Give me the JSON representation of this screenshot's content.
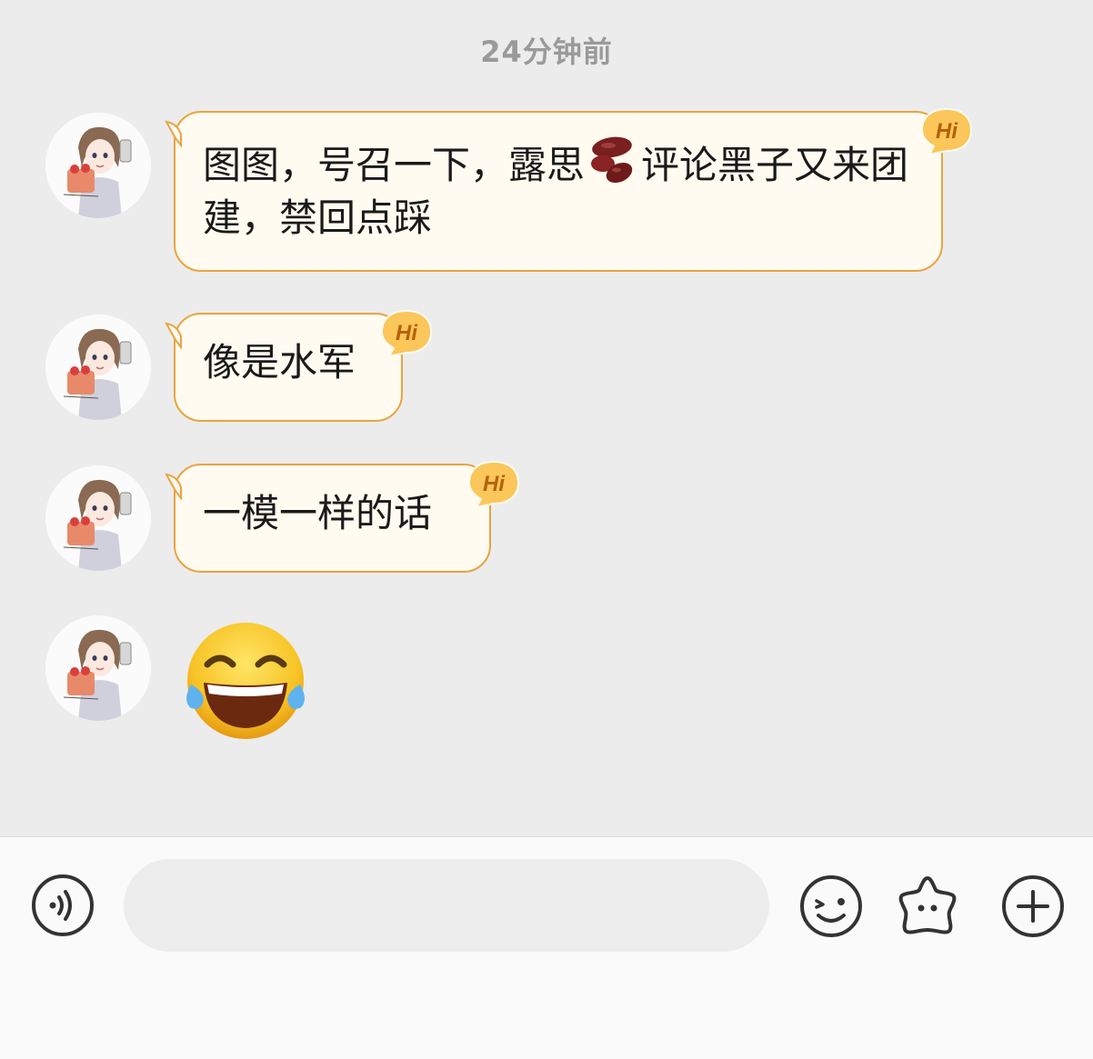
{
  "chat": {
    "timestamp": "24分钟前",
    "messages": [
      {
        "type": "text",
        "text": "图图，号召一下，露思",
        "emoji": "kidney-bean",
        "text_after": "评论黑子又来团建，禁回点踩"
      },
      {
        "type": "text",
        "text": "像是水军"
      },
      {
        "type": "text",
        "text": "一模一样的话"
      },
      {
        "type": "emoji",
        "emoji": "face-with-tears-of-joy"
      }
    ],
    "badge_label": "Hi"
  },
  "input_bar": {
    "placeholder": "",
    "value": "",
    "icons": [
      "voice-icon",
      "emoji-face-icon",
      "sticker-star-icon",
      "plus-icon"
    ]
  },
  "colors": {
    "bubble_fill": "#fffbf0",
    "bubble_border": "#e9a43f",
    "badge_fill": "#fbc65a",
    "badge_text": "#b4620a",
    "chat_background": "#ececec"
  }
}
